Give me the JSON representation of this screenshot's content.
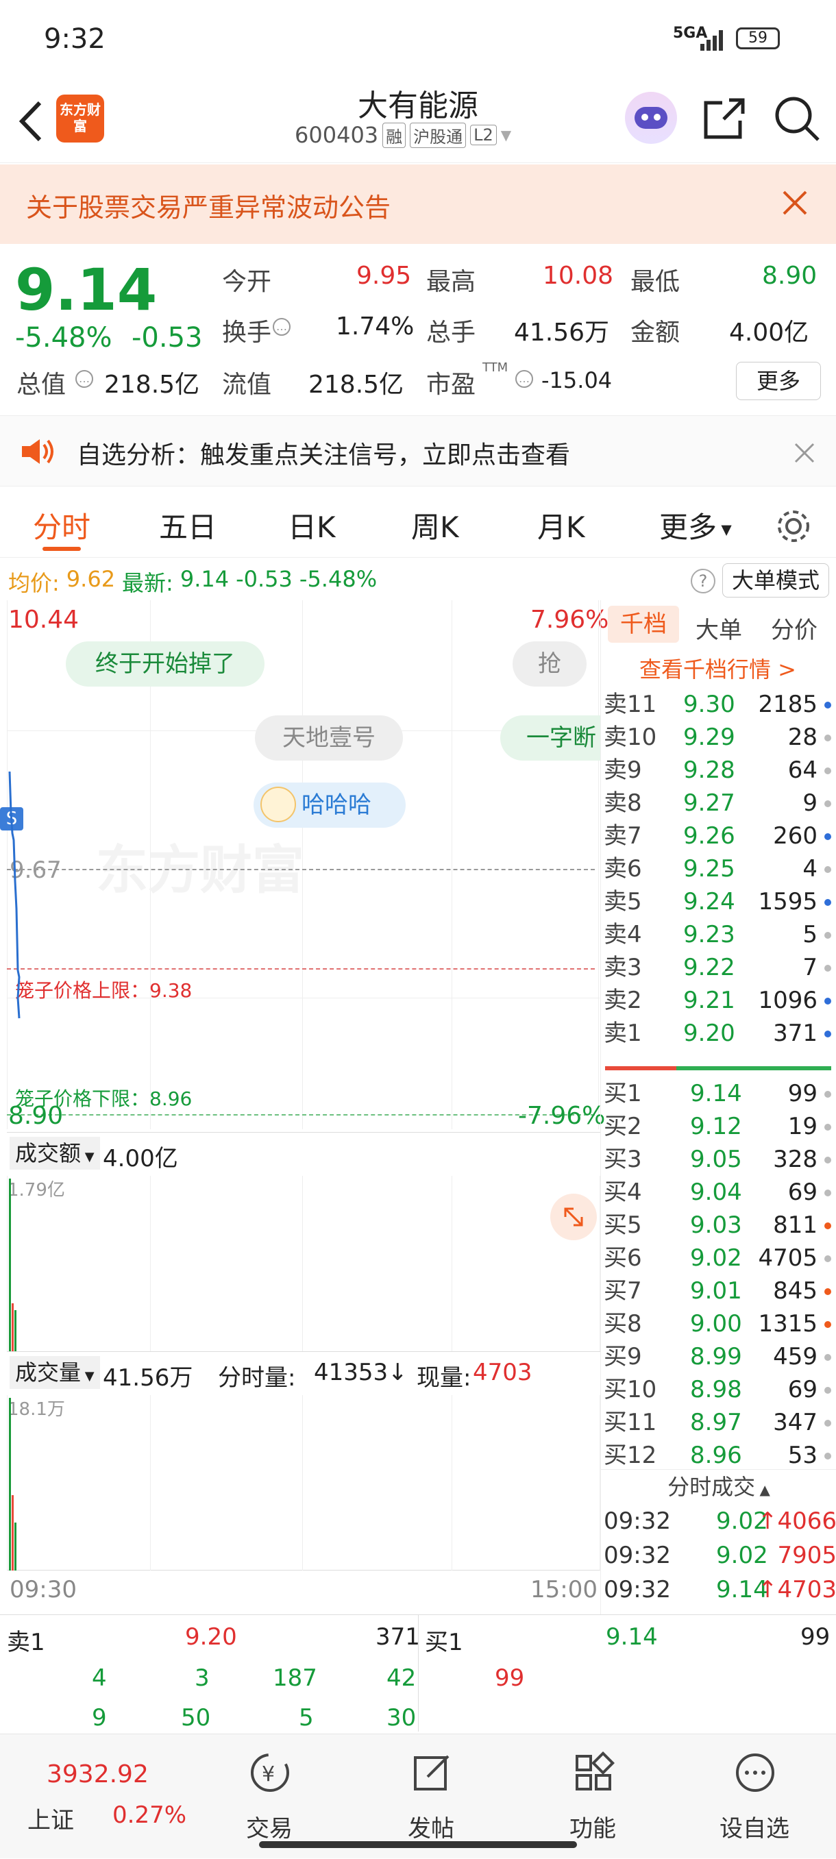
{
  "status": {
    "time": "9:32",
    "network": "5GA",
    "battery": "59"
  },
  "header": {
    "title": "大有能源",
    "code": "600403",
    "tags": [
      "融",
      "沪股通",
      "L2"
    ],
    "logo_text": "东方财富"
  },
  "notice": {
    "text": "关于股票交易严重异常波动公告"
  },
  "quote": {
    "price": "9.14",
    "change_pct": "-5.48%",
    "change": "-0.53",
    "today_open_label": "今开",
    "today_open": "9.95",
    "high_label": "最高",
    "high": "10.08",
    "low_label": "最低",
    "low": "8.90",
    "turnover_label": "换手",
    "turnover": "1.74%",
    "volume_label": "总手",
    "volume": "41.56万",
    "amount_label": "金额",
    "amount": "4.00亿",
    "mktcap_label": "总值",
    "mktcap": "218.5亿",
    "float_label": "流值",
    "float_cap": "218.5亿",
    "pe_label": "市盈",
    "pe_sup": "TTM",
    "pe": "-15.04",
    "more": "更多"
  },
  "analysis": {
    "text": "自选分析：触发重点关注信号，立即点击查看"
  },
  "tabs": [
    "分时",
    "五日",
    "日K",
    "周K",
    "月K",
    "更多"
  ],
  "avgrow": {
    "avg_label": "均价:",
    "avg": "9.62",
    "latest_label": "最新:",
    "latest": "9.14",
    "change": "-0.53",
    "pct": "-5.48%",
    "mode": "大单模式"
  },
  "chart": {
    "top_price": "10.44",
    "top_pct": "7.96%",
    "bottom_price": "8.90",
    "bottom_pct": "-7.96%",
    "prev_close": "9.67",
    "upper_limit_label": "笼子价格上限：9.38",
    "lower_limit_label": "笼子价格下限：8.96",
    "bubbles": [
      "终于开始掉了",
      "抢",
      "天地壹号",
      "一字断",
      "哈哈哈"
    ],
    "watermark": "东方财富",
    "s_badge": "S",
    "amount_label": "成交额",
    "amount_value": "4.00亿",
    "amount_max": "1.79亿",
    "volume_label": "成交量",
    "volume_value": "41.56万",
    "minute_vol_label": "分时量:",
    "minute_vol": "41353↓",
    "current_vol_label": "现量:",
    "current_vol": "4703",
    "volume_max": "18.1万",
    "time_start": "09:30",
    "time_end": "15:00"
  },
  "orderbook": {
    "tabs": [
      "千档",
      "大单",
      "分价"
    ],
    "link": "查看千档行情 >",
    "asks": [
      [
        "卖11",
        "9.30",
        "2185"
      ],
      [
        "卖10",
        "9.29",
        "28"
      ],
      [
        "卖9",
        "9.28",
        "64"
      ],
      [
        "卖8",
        "9.27",
        "9"
      ],
      [
        "卖7",
        "9.26",
        "260"
      ],
      [
        "卖6",
        "9.25",
        "4"
      ],
      [
        "卖5",
        "9.24",
        "1595"
      ],
      [
        "卖4",
        "9.23",
        "5"
      ],
      [
        "卖3",
        "9.22",
        "7"
      ],
      [
        "卖2",
        "9.21",
        "1096"
      ],
      [
        "卖1",
        "9.20",
        "371"
      ]
    ],
    "bids": [
      [
        "买1",
        "9.14",
        "99"
      ],
      [
        "买2",
        "9.12",
        "19"
      ],
      [
        "买3",
        "9.05",
        "328"
      ],
      [
        "买4",
        "9.04",
        "69"
      ],
      [
        "买5",
        "9.03",
        "811"
      ],
      [
        "买6",
        "9.02",
        "4705"
      ],
      [
        "买7",
        "9.01",
        "845"
      ],
      [
        "买8",
        "9.00",
        "1315"
      ],
      [
        "买9",
        "8.99",
        "459"
      ],
      [
        "买10",
        "8.98",
        "69"
      ],
      [
        "买11",
        "8.97",
        "347"
      ],
      [
        "买12",
        "8.96",
        "53"
      ]
    ],
    "trades_label": "分时成交",
    "trades": [
      [
        "09:32",
        "9.02",
        "↑4066"
      ],
      [
        "09:32",
        "9.02",
        "7905"
      ],
      [
        "09:32",
        "9.14",
        "↑4703"
      ]
    ]
  },
  "depth": {
    "sell_label": "卖1",
    "sell_price": "9.20",
    "sell_qty": "371",
    "buy_label": "买1",
    "buy_price": "9.14",
    "buy_qty": "99",
    "sell_row1": [
      "4",
      "3",
      "187",
      "42"
    ],
    "sell_row2": [
      "9",
      "50",
      "5",
      "30"
    ],
    "buy_row1": [
      "99"
    ]
  },
  "nav": {
    "index_value": "3932.92",
    "index_name": "上证",
    "index_pct": "0.27%",
    "items": [
      "交易",
      "发帖",
      "功能",
      "设自选"
    ]
  }
}
